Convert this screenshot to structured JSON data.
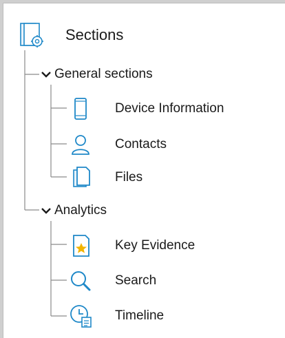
{
  "tree": {
    "root": {
      "label": "Sections",
      "icon": "sections-gear-icon"
    },
    "groups": [
      {
        "label": "General sections",
        "expanded": true,
        "items": [
          {
            "label": "Device Information",
            "icon": "device-phone-icon"
          },
          {
            "label": "Contacts",
            "icon": "contact-person-icon"
          },
          {
            "label": "Files",
            "icon": "files-icon"
          }
        ]
      },
      {
        "label": "Analytics",
        "expanded": true,
        "items": [
          {
            "label": "Key Evidence",
            "icon": "key-evidence-star-icon"
          },
          {
            "label": "Search",
            "icon": "search-magnifier-icon"
          },
          {
            "label": "Timeline",
            "icon": "timeline-clock-icon"
          }
        ]
      }
    ]
  },
  "colors": {
    "icon_blue": "#1e88c8",
    "star_yellow": "#f2b400",
    "tree_line": "#8a8a8a"
  }
}
